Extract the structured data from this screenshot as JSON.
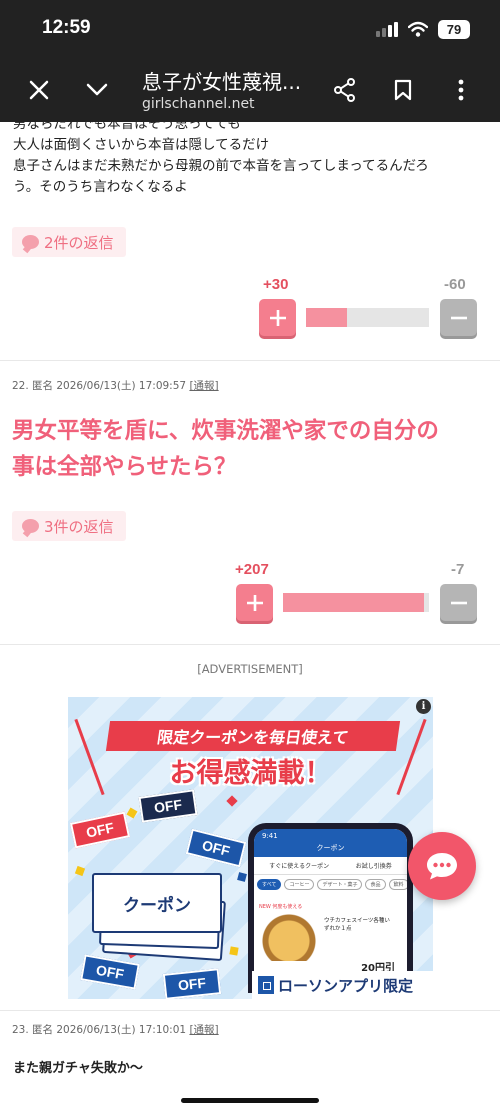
{
  "status_bar": {
    "time": "12:59",
    "battery": "79"
  },
  "header": {
    "title": "息子が女性蔑視...",
    "url": "girlschannel.net"
  },
  "comment_21": {
    "cut_line": "男ならだれでも本音はそう思ってても",
    "lines": [
      "大人は面倒くさいから本音は隠してるだけ",
      "息子さんはまだ未熟だから母親の前で本音を言ってしまってるんだろ",
      "う。そのうち言わなくなるよ"
    ],
    "replies": "2件の返信",
    "plus": "+30",
    "minus": "-60",
    "ratio": 0.33
  },
  "comment_22": {
    "meta": "22. 匿名 2026/06/13(土) 17:09:57",
    "report": "[通報]",
    "lines": [
      "男女平等を盾に、炊事洗濯や家での自分の",
      "事は全部やらせたら？"
    ],
    "replies": "3件の返信",
    "plus": "+207",
    "minus": "-7",
    "ratio": 0.967
  },
  "ad": {
    "label": "[ADVERTISEMENT]",
    "headline1": "限定クーポンを毎日使えて",
    "headline2": "お得感満載！",
    "off": "OFF",
    "ticket": "クーポン",
    "phone": {
      "time": "9:41",
      "title": "クーポン",
      "tabs": [
        "すぐに使えるクーポン",
        "お試し引換券"
      ],
      "chips": [
        "すべて",
        "コーヒー",
        "デザート・菓子",
        "食品",
        "飲料"
      ],
      "new_badge": "NEW 何度も使える",
      "item_desc": "ウチカフェスイーツ各種いずれか１点",
      "price": "20円引"
    },
    "footer": "ローソンアプリ限定"
  },
  "comment_23": {
    "meta": "23. 匿名 2026/06/13(土) 17:10:01",
    "report": "[通報]",
    "text": "また親ガチャ失敗か〜"
  },
  "colors": {
    "accent_pink": "#f0607a",
    "plus": "#f47e8e",
    "minus": "#b5b5b5",
    "header_bg": "#222222"
  }
}
